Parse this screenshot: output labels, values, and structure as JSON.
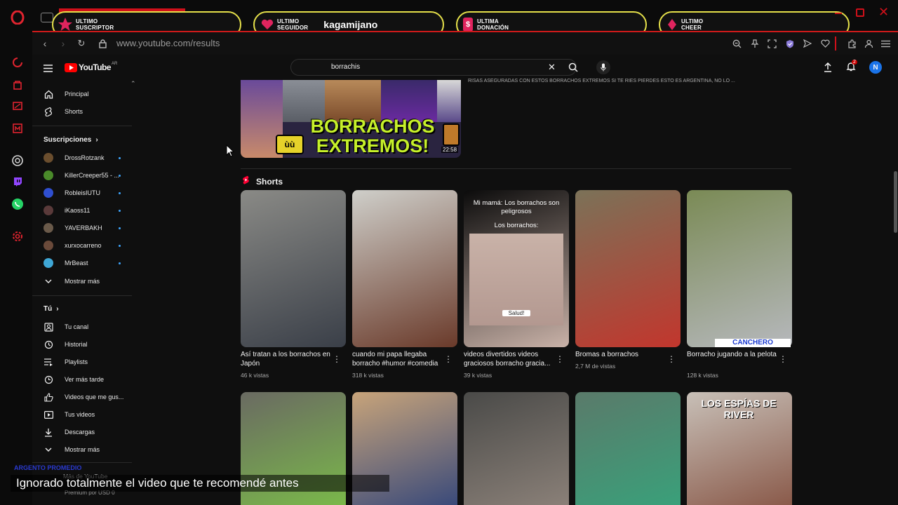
{
  "overlay": {
    "alerts": [
      {
        "label": "ULTIMO\nSUSCRIPTOR",
        "value": ""
      },
      {
        "label": "ULTIMO\nSEGUIDOR",
        "value": "kagamijano"
      },
      {
        "label": "ULTIMA\nDONACIÓN",
        "value": ""
      },
      {
        "label": "ULTIMO\nCHEER",
        "value": ""
      }
    ]
  },
  "browser": {
    "url": "www.youtube.com/results"
  },
  "youtube": {
    "logo": "YouTube",
    "region": "AR",
    "search_query": "borrachis",
    "notification_count": "2",
    "account_initial": "N"
  },
  "sidebar": {
    "main_items": [
      {
        "label": "Principal",
        "icon": "home-icon"
      },
      {
        "label": "Shorts",
        "icon": "shorts-icon"
      }
    ],
    "subscriptions_title": "Suscripciones",
    "subscriptions": [
      {
        "name": "DrossRotzank",
        "color": "#6b4e2e"
      },
      {
        "name": "KillerCreeper55 - ...",
        "color": "#4a8a2a"
      },
      {
        "name": "RobleisIUTU",
        "color": "#2f4fd0"
      },
      {
        "name": "iKaoss11",
        "color": "#5a3a3a"
      },
      {
        "name": "YAVERBAKH",
        "color": "#6a5a4a"
      },
      {
        "name": "xurxocarreno",
        "color": "#6a4a3a"
      },
      {
        "name": "MrBeast",
        "color": "#3fa7d6"
      }
    ],
    "show_more": "Mostrar más",
    "you_title": "Tú",
    "you_items": [
      {
        "label": "Tu canal",
        "icon": "channel-icon"
      },
      {
        "label": "Historial",
        "icon": "history-icon"
      },
      {
        "label": "Playlists",
        "icon": "playlists-icon"
      },
      {
        "label": "Ver más tarde",
        "icon": "clock-icon"
      },
      {
        "label": "Videos que me gus...",
        "icon": "thumbs-up-icon"
      },
      {
        "label": "Tus videos",
        "icon": "your-videos-icon"
      },
      {
        "label": "Descargas",
        "icon": "download-icon"
      }
    ],
    "show_more_2": "Mostrar más",
    "more_from_youtube": "Más de YouTube",
    "premium": "Premium por USD 0"
  },
  "results": {
    "top_video": {
      "thumb_text": "BORRACHOS\nEXTREMOS!",
      "duration": "22:58",
      "snippet": "RISAS ASEGURADAS CON ESTOS BORRACHOS EXTREMOS SI TE RIES PIERDES ESTO ES ARGENTINA, NO LO ..."
    },
    "shorts_title": "Shorts",
    "shorts_row1": [
      {
        "title": "Así tratan a los borrachos en Japón",
        "views": "46 k vistas",
        "colors": [
          "#8a8a86",
          "#3a3f48"
        ]
      },
      {
        "title": "cuando mi papa llegaba borracho #humor #comedia",
        "views": "318 k vistas",
        "colors": [
          "#cfcfca",
          "#6a3a2a"
        ]
      },
      {
        "title": "videos divertidos videos graciosos borracho gracia...",
        "views": "39 k vistas",
        "colors": [
          "#0b0b0b",
          "#c9b2a8"
        ]
      },
      {
        "title": "Bromas a borrachos",
        "views": "2,7 M de vistas",
        "colors": [
          "#7b7258",
          "#c2362d"
        ]
      },
      {
        "title": "Borracho jugando a la pelota",
        "views": "128 k vistas",
        "colors": [
          "#7a8a55",
          "#b6b8bc"
        ]
      }
    ],
    "short3_overlay": {
      "top": "Mi mamá: Los borrachos son peligrosos",
      "mid": "Los borrachos:",
      "bottom": "Salud!"
    },
    "short5_banner": "CANCHERO",
    "shorts_row2": [
      {
        "colors": [
          "#6a6a62",
          "#7ab84a"
        ]
      },
      {
        "colors": [
          "#c8a47a",
          "#3a4a7a"
        ]
      },
      {
        "colors": [
          "#4a4a48",
          "#8a8078"
        ]
      },
      {
        "colors": [
          "#5a7a6a",
          "#3aa07a"
        ]
      },
      {
        "colors": [
          "#c8c0b8",
          "#8a5a4a"
        ]
      }
    ],
    "short10_banner": "LOS ESPÍAS DE RIVER"
  },
  "stream": {
    "subtitle": "Ignorado totalmente el video que te recomendé antes",
    "overlay_name": "ARGENTO PROMEDIO"
  },
  "colors": {
    "accent_red": "#ff0033",
    "overlay_yellow": "#e5e04a",
    "link_blue": "#3ea6ff"
  }
}
